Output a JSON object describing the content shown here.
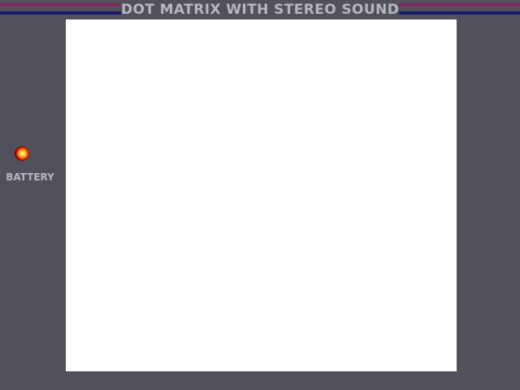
{
  "header": {
    "title": "DOT MATRIX WITH STEREO SOUND"
  },
  "indicator": {
    "label": "BATTERY",
    "state": "on"
  },
  "colors": {
    "body": "#51515e",
    "stripe_top": "#7b2a5c",
    "stripe_bottom": "#1a1a6a",
    "screen": "#ffffff",
    "label_text": "#b6b6c2"
  }
}
